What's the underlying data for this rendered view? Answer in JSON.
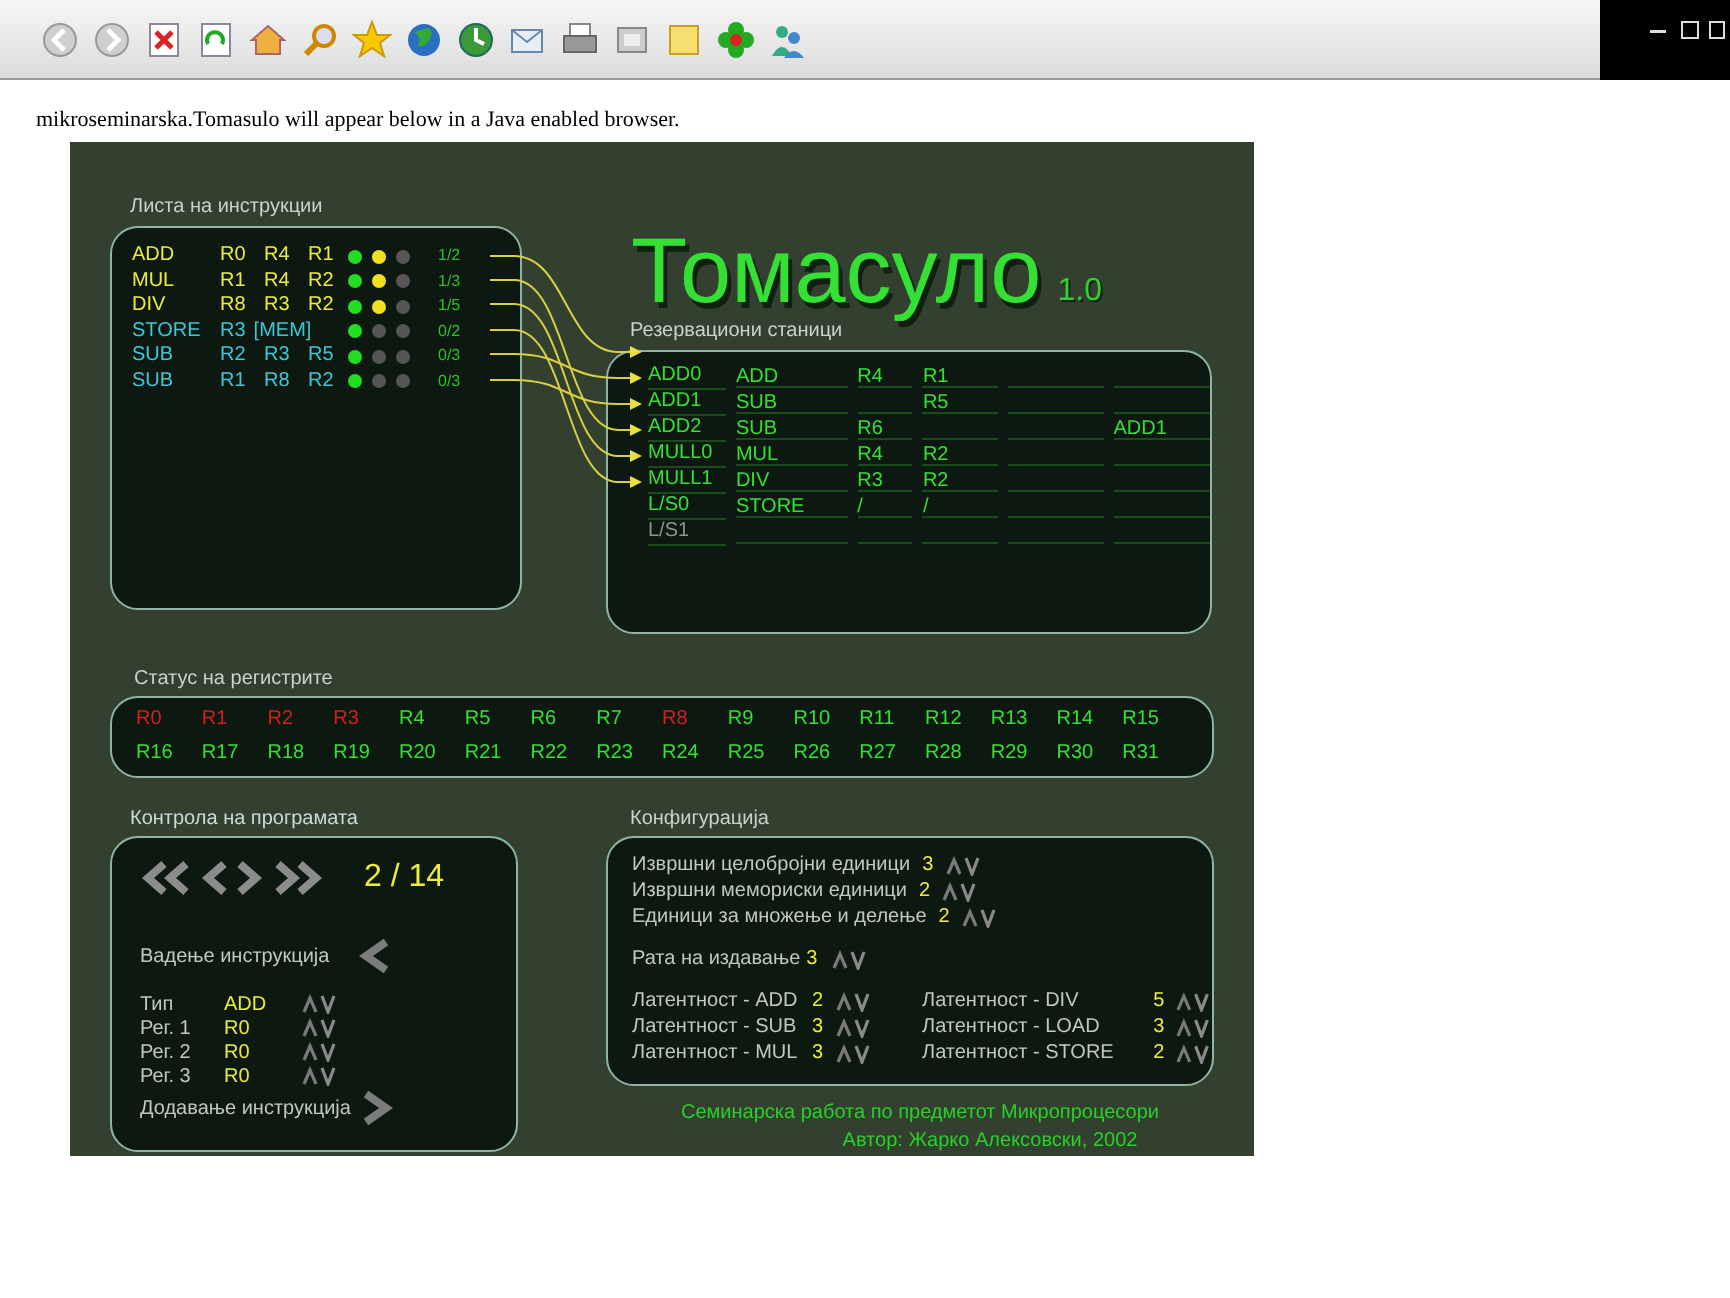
{
  "page_text": "mikroseminarska.Tomasulo will appear below in a Java enabled browser.",
  "applet": {
    "title": "Томасуло",
    "version": "1.0",
    "instructions": {
      "label": "Листа на инструкции",
      "rows": [
        {
          "op": "ADD",
          "operands": [
            "R0",
            "R4",
            "R1"
          ],
          "issued": true,
          "dots": [
            {
              "color": "#22dd22"
            },
            {
              "color": "#f0e020"
            },
            {
              "color": "#555555"
            }
          ],
          "progress": "1/2"
        },
        {
          "op": "MUL",
          "operands": [
            "R1",
            "R4",
            "R2"
          ],
          "issued": true,
          "dots": [
            {
              "color": "#22dd22"
            },
            {
              "color": "#f0e020"
            },
            {
              "color": "#555555"
            }
          ],
          "progress": "1/3"
        },
        {
          "op": "DIV",
          "operands": [
            "R8",
            "R3",
            "R2"
          ],
          "issued": true,
          "dots": [
            {
              "color": "#22dd22"
            },
            {
              "color": "#f0e020"
            },
            {
              "color": "#555555"
            }
          ],
          "progress": "1/5"
        },
        {
          "op": "STORE",
          "operands": [
            "R3",
            "[MEM]"
          ],
          "issued": false,
          "dots": [
            {
              "color": "#22dd22"
            },
            {
              "color": "#555555"
            },
            {
              "color": "#555555"
            }
          ],
          "progress": "0/2"
        },
        {
          "op": "SUB",
          "operands": [
            "R2",
            "R3",
            "R5"
          ],
          "issued": false,
          "dots": [
            {
              "color": "#22dd22"
            },
            {
              "color": "#555555"
            },
            {
              "color": "#555555"
            }
          ],
          "progress": "0/3"
        },
        {
          "op": "SUB",
          "operands": [
            "R1",
            "R8",
            "R2"
          ],
          "issued": false,
          "dots": [
            {
              "color": "#22dd22"
            },
            {
              "color": "#555555"
            },
            {
              "color": "#555555"
            }
          ],
          "progress": "0/3"
        }
      ]
    },
    "stations": {
      "label": "Резервациони станици",
      "rows": [
        {
          "name": "ADD0",
          "busy": true,
          "op": "ADD",
          "column_3": "R4",
          "column_4": "R1"
        },
        {
          "name": "ADD1",
          "busy": true,
          "op": "SUB",
          "column_4": "R5"
        },
        {
          "name": "ADD2",
          "busy": true,
          "op": "SUB",
          "column_3": "R6",
          "column_6": "ADD1"
        },
        {
          "name": "MULL0",
          "busy": true,
          "op": "MUL",
          "column_3": "R4",
          "column_4": "R2"
        },
        {
          "name": "MULL1",
          "busy": true,
          "op": "DIV",
          "column_3": "R3",
          "column_4": "R2"
        },
        {
          "name": "L/S0",
          "busy": true,
          "op": "STORE",
          "column_3": "/",
          "column_4": "/"
        },
        {
          "name": "L/S1",
          "busy": false
        }
      ]
    },
    "registers": {
      "label": "Статус на регистрите",
      "items": [
        {
          "name": "R0",
          "busy": true
        },
        {
          "name": "R1",
          "busy": true
        },
        {
          "name": "R2",
          "busy": true
        },
        {
          "name": "R3",
          "busy": true
        },
        {
          "name": "R4",
          "busy": false
        },
        {
          "name": "R5",
          "busy": false
        },
        {
          "name": "R6",
          "busy": false
        },
        {
          "name": "R7",
          "busy": false
        },
        {
          "name": "R8",
          "busy": true
        },
        {
          "name": "R9",
          "busy": false
        },
        {
          "name": "R10",
          "busy": false
        },
        {
          "name": "R11",
          "busy": false
        },
        {
          "name": "R12",
          "busy": false
        },
        {
          "name": "R13",
          "busy": false
        },
        {
          "name": "R14",
          "busy": false
        },
        {
          "name": "R15",
          "busy": false
        },
        {
          "name": "R16",
          "busy": false
        },
        {
          "name": "R17",
          "busy": false
        },
        {
          "name": "R18",
          "busy": false
        },
        {
          "name": "R19",
          "busy": false
        },
        {
          "name": "R20",
          "busy": false
        },
        {
          "name": "R21",
          "busy": false
        },
        {
          "name": "R22",
          "busy": false
        },
        {
          "name": "R23",
          "busy": false
        },
        {
          "name": "R24",
          "busy": false
        },
        {
          "name": "R25",
          "busy": false
        },
        {
          "name": "R26",
          "busy": false
        },
        {
          "name": "R27",
          "busy": false
        },
        {
          "name": "R28",
          "busy": false
        },
        {
          "name": "R29",
          "busy": false
        },
        {
          "name": "R30",
          "busy": false
        },
        {
          "name": "R31",
          "busy": false
        }
      ]
    },
    "control": {
      "label": "Контрола на програмата",
      "counter": "2 / 14",
      "remove_label": "Вадење инструкција",
      "fields": [
        {
          "label": "Тип",
          "value": "ADD"
        },
        {
          "label": "Рег. 1",
          "value": "R0"
        },
        {
          "label": "Рег. 2",
          "value": "R0"
        },
        {
          "label": "Рег. 3",
          "value": "R0"
        }
      ],
      "add_label": "Додавање инструкција"
    },
    "configuration": {
      "label": "Конфигурација",
      "units": [
        {
          "label": "Извршни целобројни единици",
          "value": "3"
        },
        {
          "label": "Извршни мемориски единици",
          "value": "2"
        },
        {
          "label": "Единици за множење и делење",
          "value": "2"
        }
      ],
      "issue_rate": {
        "label": "Рата на издавање",
        "value": "3"
      },
      "latencies": [
        {
          "label": "Латентност - ADD",
          "value": "2"
        },
        {
          "label": "Латентност - SUB",
          "value": "3"
        },
        {
          "label": "Латентност - MUL",
          "value": "3"
        },
        {
          "label": "Латентност - DIV",
          "value": "5"
        },
        {
          "label": "Латентност - LOAD",
          "value": "3"
        },
        {
          "label": "Латентност - STORE",
          "value": "2"
        }
      ]
    },
    "footer": [
      "Семинарска работа по предметот Микропроцесори",
      "Автор: Жарко Алексовски, 2002"
    ]
  }
}
